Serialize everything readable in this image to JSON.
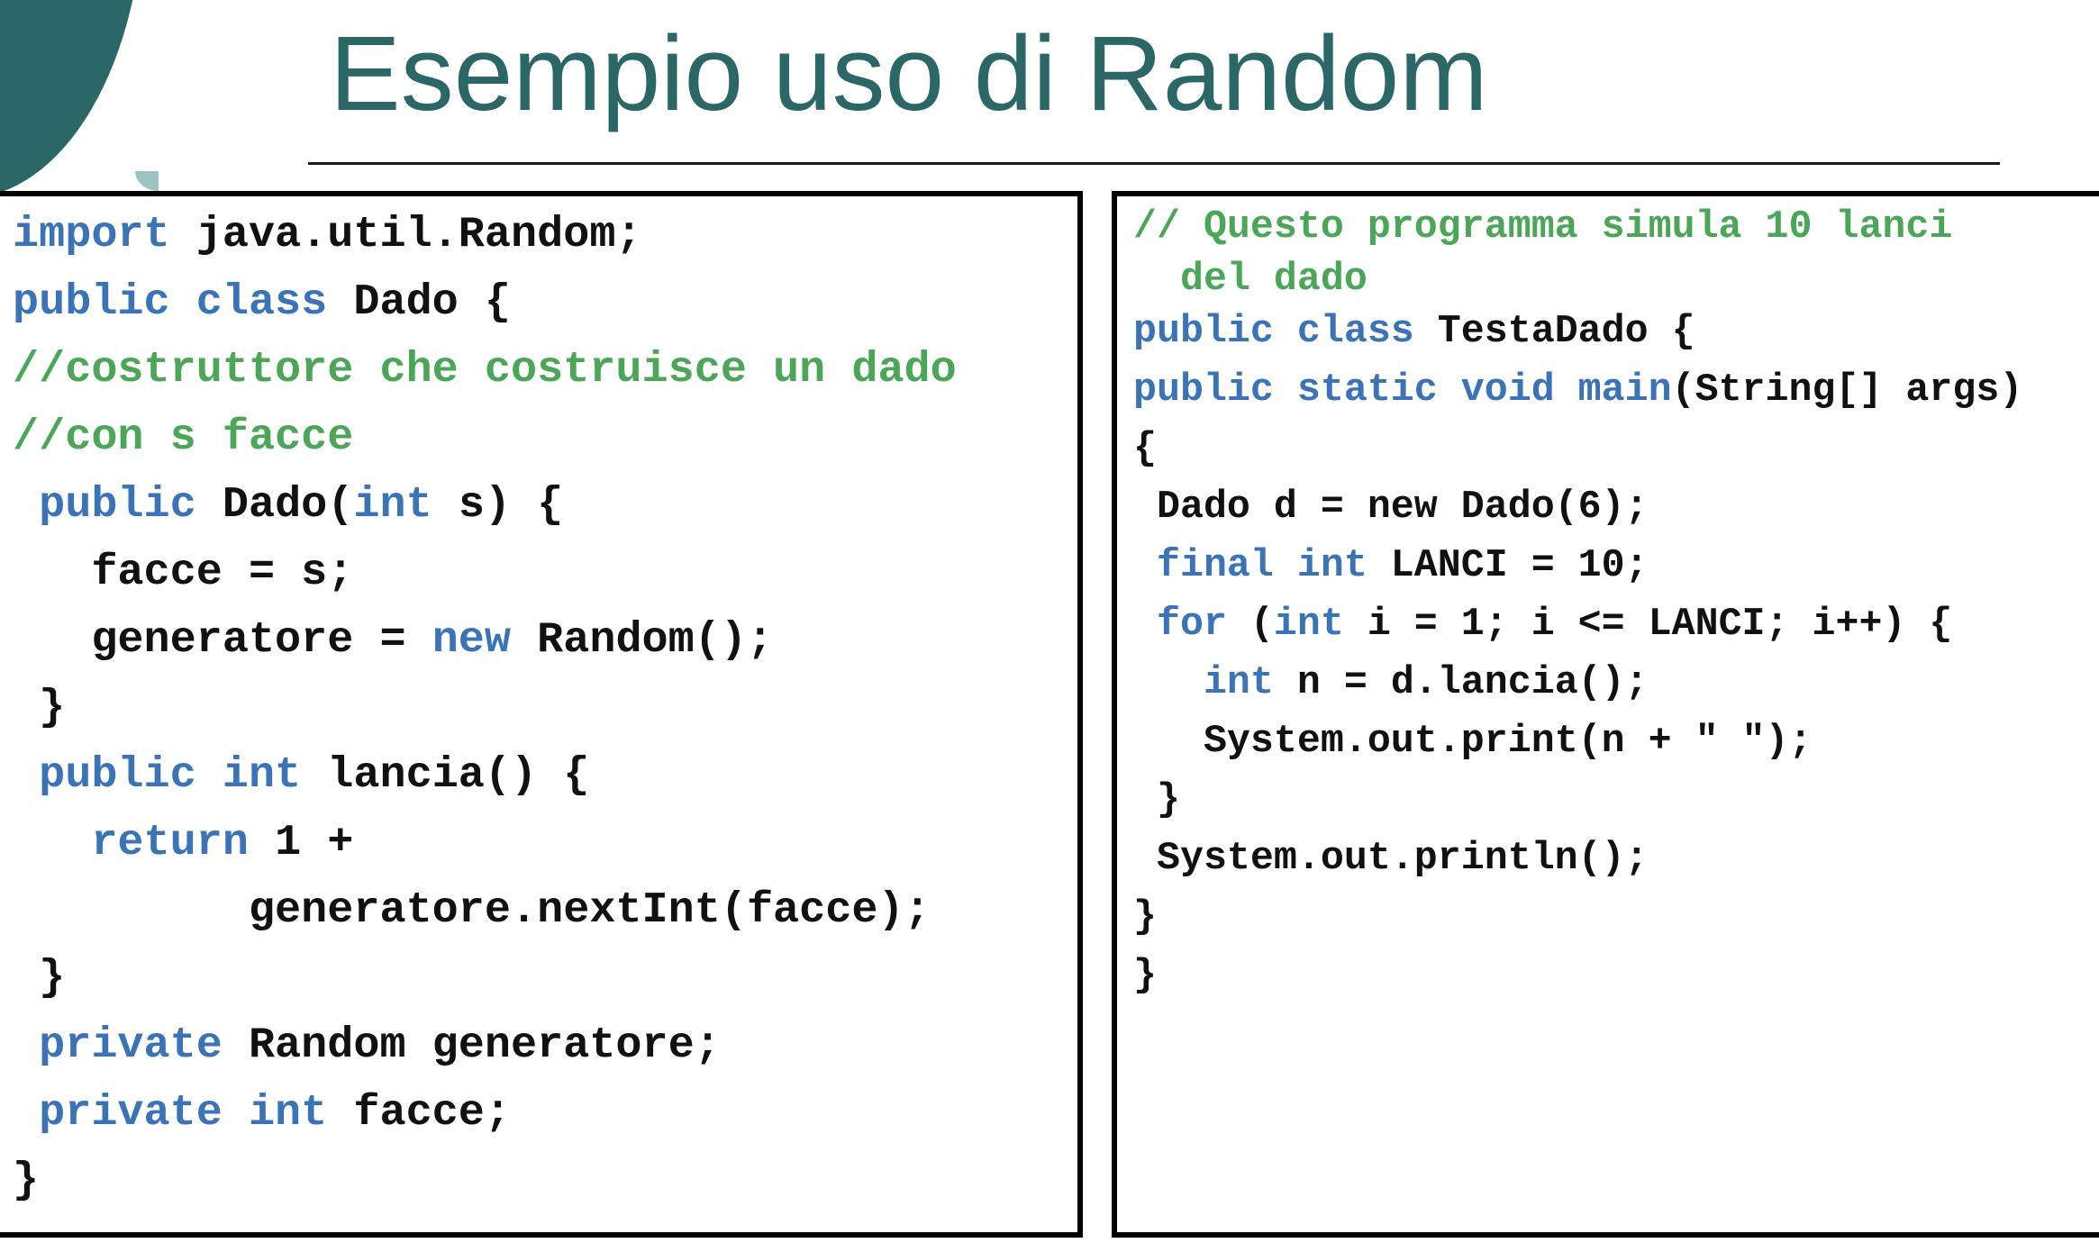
{
  "slide": {
    "title": "Esempio uso di Random"
  },
  "left_code": [
    {
      "indent": "",
      "parts": [
        {
          "t": "import",
          "k": "kw"
        },
        {
          "t": " java.util.Random;",
          "k": ""
        }
      ]
    },
    {
      "indent": "",
      "parts": [
        {
          "t": "public class",
          "k": "kw"
        },
        {
          "t": " Dado {",
          "k": ""
        }
      ]
    },
    {
      "indent": "",
      "parts": [
        {
          "t": "//costruttore che costruisce un dado",
          "k": "cm"
        }
      ]
    },
    {
      "indent": "",
      "parts": [
        {
          "t": "//con s facce",
          "k": "cm"
        }
      ]
    },
    {
      "indent": " ",
      "parts": [
        {
          "t": "public",
          "k": "kw"
        },
        {
          "t": " Dado(",
          "k": ""
        },
        {
          "t": "int",
          "k": "kw"
        },
        {
          "t": " s) {",
          "k": ""
        }
      ]
    },
    {
      "indent": "   ",
      "parts": [
        {
          "t": "facce = s;",
          "k": ""
        }
      ]
    },
    {
      "indent": "   ",
      "parts": [
        {
          "t": "generatore = ",
          "k": ""
        },
        {
          "t": "new",
          "k": "kw"
        },
        {
          "t": " Random();",
          "k": ""
        }
      ]
    },
    {
      "indent": " ",
      "parts": [
        {
          "t": "}",
          "k": ""
        }
      ]
    },
    {
      "indent": " ",
      "parts": [
        {
          "t": "public int",
          "k": "kw"
        },
        {
          "t": " lancia() {",
          "k": ""
        }
      ]
    },
    {
      "indent": "   ",
      "parts": [
        {
          "t": "return",
          "k": "kw"
        },
        {
          "t": " 1 +",
          "k": ""
        }
      ]
    },
    {
      "indent": "         ",
      "parts": [
        {
          "t": "generatore.nextInt(facce);",
          "k": ""
        }
      ]
    },
    {
      "indent": " ",
      "parts": [
        {
          "t": "}",
          "k": ""
        }
      ]
    },
    {
      "indent": " ",
      "parts": [
        {
          "t": "private",
          "k": "kw"
        },
        {
          "t": " Random generatore;",
          "k": ""
        }
      ]
    },
    {
      "indent": " ",
      "parts": [
        {
          "t": "private int",
          "k": "kw"
        },
        {
          "t": " facce;",
          "k": ""
        }
      ]
    },
    {
      "indent": "",
      "parts": [
        {
          "t": "}",
          "k": ""
        }
      ]
    }
  ],
  "right_code": [
    {
      "indent": "",
      "short": true,
      "parts": [
        {
          "t": "// Questo programma simula 10 lanci",
          "k": "cm"
        }
      ]
    },
    {
      "indent": "  ",
      "short": true,
      "parts": [
        {
          "t": "del dado",
          "k": "cm"
        }
      ]
    },
    {
      "indent": "",
      "parts": [
        {
          "t": "public class",
          "k": "kw"
        },
        {
          "t": " TestaDado {",
          "k": ""
        }
      ]
    },
    {
      "indent": "",
      "parts": [
        {
          "t": "public static void main",
          "k": "kw"
        },
        {
          "t": "(String[] args)",
          "k": ""
        }
      ]
    },
    {
      "indent": "",
      "parts": [
        {
          "t": "{",
          "k": ""
        }
      ]
    },
    {
      "indent": " ",
      "parts": [
        {
          "t": "Dado d = new Dado(6);",
          "k": ""
        }
      ]
    },
    {
      "indent": " ",
      "parts": [
        {
          "t": "final int",
          "k": "kw"
        },
        {
          "t": " LANCI = 10;",
          "k": ""
        }
      ]
    },
    {
      "indent": " ",
      "parts": [
        {
          "t": "for",
          "k": "kw"
        },
        {
          "t": " (",
          "k": ""
        },
        {
          "t": "int",
          "k": "kw"
        },
        {
          "t": " i = 1; i <= LANCI; i++) {",
          "k": ""
        }
      ]
    },
    {
      "indent": "   ",
      "parts": [
        {
          "t": "int",
          "k": "kw"
        },
        {
          "t": " n = d.lancia();",
          "k": ""
        }
      ]
    },
    {
      "indent": "   ",
      "parts": [
        {
          "t": "System.out.print(n + \" \");",
          "k": ""
        }
      ]
    },
    {
      "indent": " ",
      "parts": [
        {
          "t": "}",
          "k": ""
        }
      ]
    },
    {
      "indent": " ",
      "parts": [
        {
          "t": "System.out.println();",
          "k": ""
        }
      ]
    },
    {
      "indent": "",
      "parts": [
        {
          "t": "}",
          "k": ""
        }
      ]
    },
    {
      "indent": "",
      "parts": [
        {
          "t": "}",
          "k": ""
        }
      ]
    }
  ],
  "colors": {
    "title": "#2c6768",
    "keyword": "#3a73b8",
    "comment": "#4ba657",
    "text": "#111111",
    "corner": "#2c6768"
  }
}
